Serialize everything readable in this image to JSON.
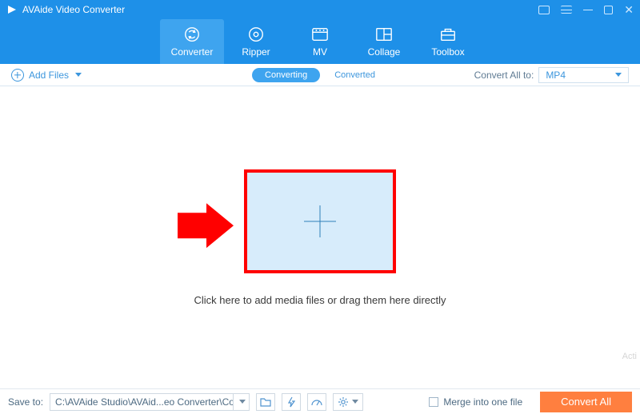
{
  "title": "AVAide Video Converter",
  "nav": {
    "items": [
      {
        "label": "Converter"
      },
      {
        "label": "Ripper"
      },
      {
        "label": "MV"
      },
      {
        "label": "Collage"
      },
      {
        "label": "Toolbox"
      }
    ]
  },
  "subbar": {
    "add_files_label": "Add Files",
    "mode_converting": "Converting",
    "mode_converted": "Converted",
    "convert_all_label": "Convert All to:",
    "format_selected": "MP4"
  },
  "main": {
    "drop_caption": "Click here to add media files or drag them here directly"
  },
  "bottom": {
    "save_to_label": "Save to:",
    "save_path": "C:\\AVAide Studio\\AVAid...eo Converter\\Converted",
    "merge_label": "Merge into one file",
    "convert_button": "Convert All"
  },
  "watermark": "Acti"
}
